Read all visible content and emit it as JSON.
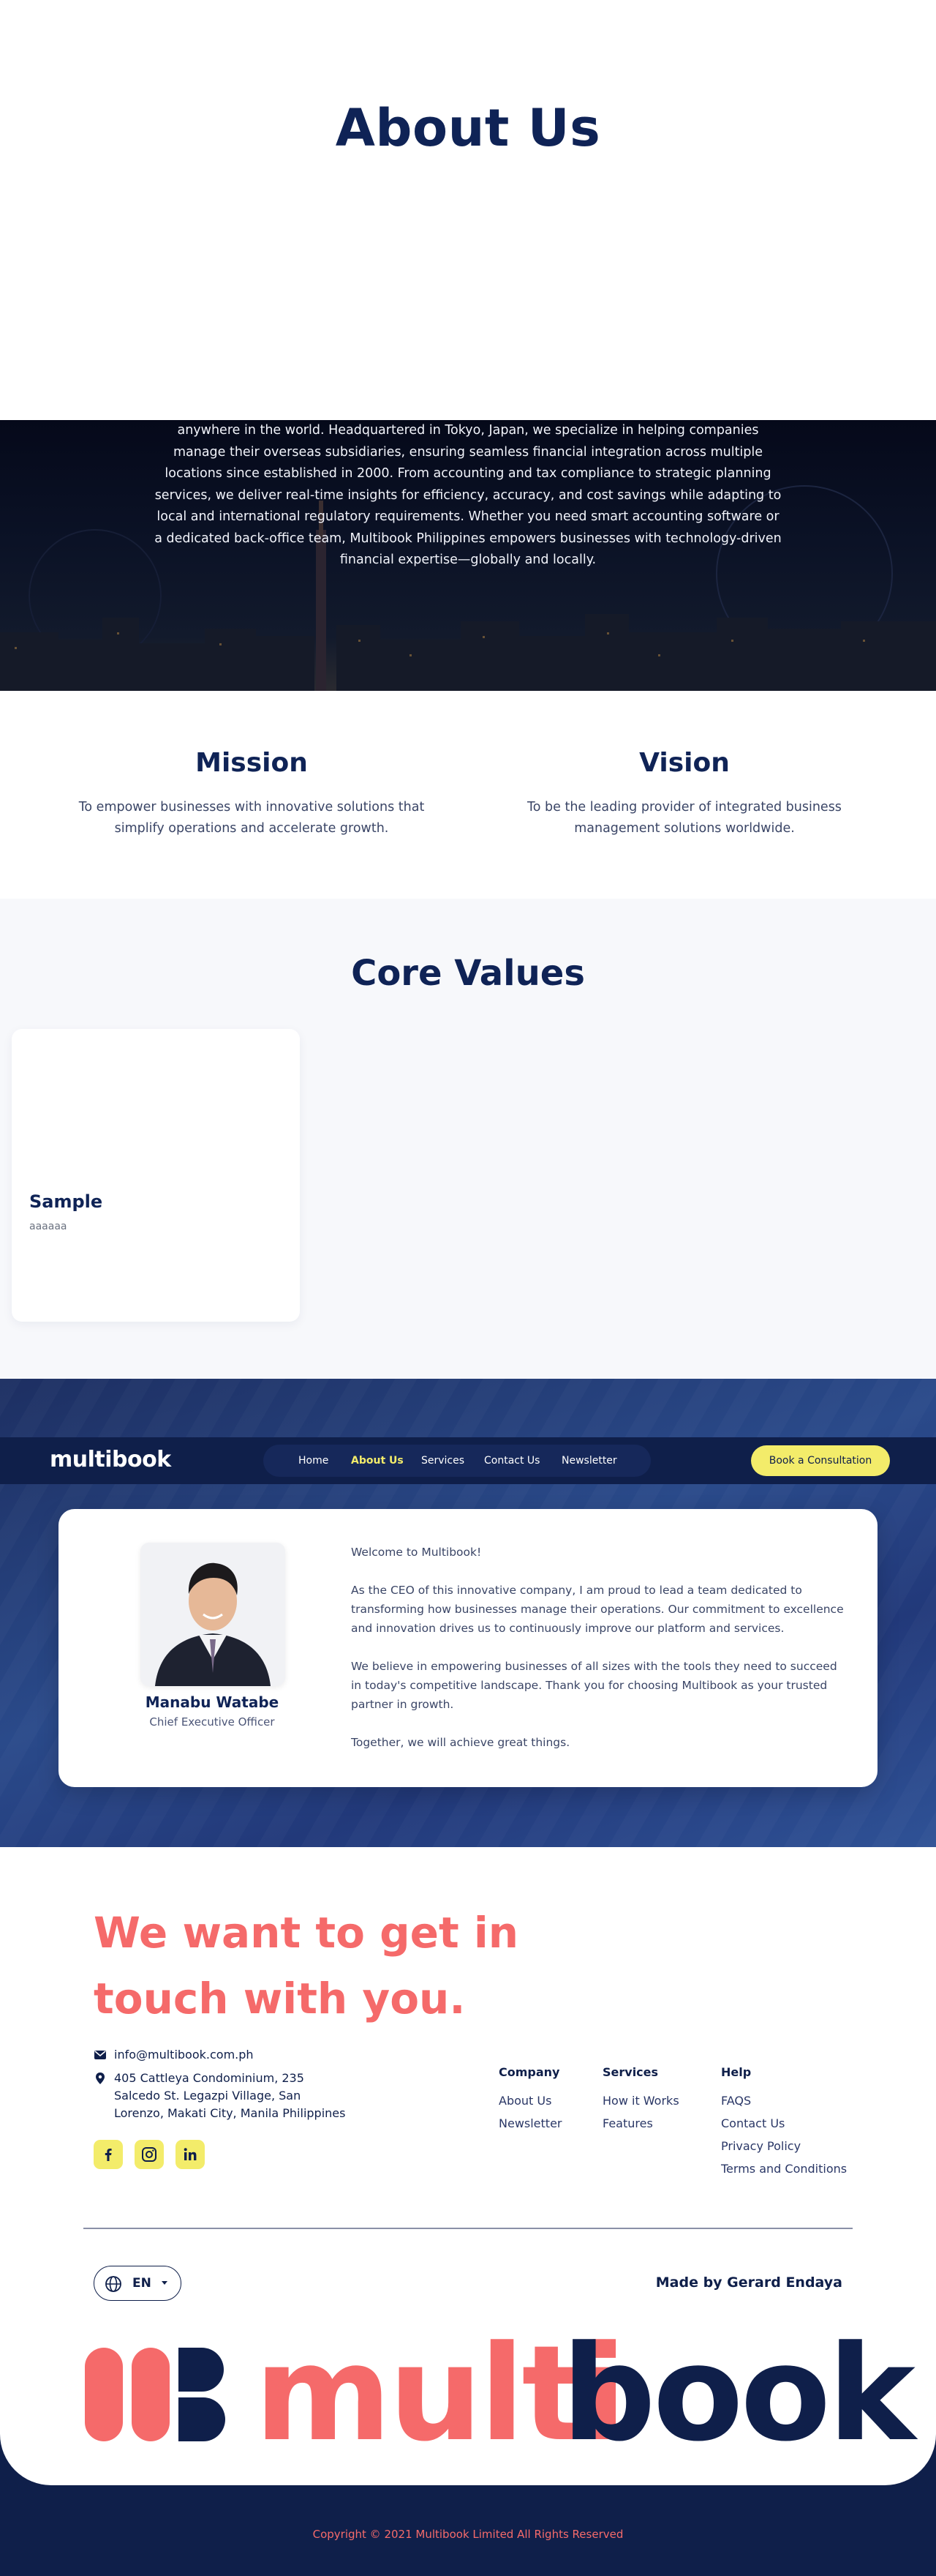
{
  "hero": {
    "title": "About Us"
  },
  "intro": {
    "text": "anywhere in the world. Headquartered in Tokyo, Japan, we specialize in helping companies manage their overseas subsidiaries, ensuring seamless financial integration across multiple locations since established in 2000. From accounting and tax compliance to strategic planning services, we deliver real-time insights for efficiency, accuracy, and cost savings while adapting to local and international regulatory requirements. Whether you need smart accounting software or a dedicated back-office team, Multibook Philippines empowers businesses with technology-driven financial expertise—globally and locally."
  },
  "mission": {
    "title": "Mission",
    "text": "To empower businesses with innovative solutions that simplify operations and accelerate growth."
  },
  "vision": {
    "title": "Vision",
    "text": "To be the leading provider of integrated business management solutions worldwide."
  },
  "core_values": {
    "title": "Core Values",
    "cards": [
      {
        "title": "Sample",
        "text": "aaaaaa"
      }
    ]
  },
  "navbar": {
    "logo": "multibook",
    "items": [
      {
        "label": "Home",
        "active": false
      },
      {
        "label": "About Us",
        "active": true
      },
      {
        "label": "Services",
        "active": false
      },
      {
        "label": "Contact Us",
        "active": false
      },
      {
        "label": "Newsletter",
        "active": false
      }
    ],
    "cta": "Book a Consultation"
  },
  "ceo": {
    "name": "Manabu Watabe",
    "role": "Chief Executive Officer",
    "paragraphs": [
      "Welcome to Multibook!",
      "As the CEO of this innovative company, I am proud to lead a team dedicated to transforming how businesses manage their operations. Our commitment to excellence and innovation drives us to continuously improve our platform and services.",
      "We believe in empowering businesses of all sizes with the tools they need to succeed in today's competitive landscape. Thank you for choosing Multibook as your trusted partner in growth.",
      "Together, we will achieve great things."
    ]
  },
  "contact": {
    "headline": "We want to get in touch with you.",
    "email": "info@multibook.com.ph",
    "address": "405 Cattleya Condominium, 235 Salcedo St. Legazpi Village, San Lorenzo, Makati City, Manila Philippines",
    "social": [
      "facebook-icon",
      "instagram-icon",
      "linkedin-icon"
    ]
  },
  "footer": {
    "columns": [
      {
        "title": "Company",
        "links": [
          "About Us",
          "Newsletter"
        ]
      },
      {
        "title": "Services",
        "links": [
          "How it Works",
          "Features"
        ]
      },
      {
        "title": "Help",
        "links": [
          "FAQS",
          "Contact Us",
          "Privacy Policy",
          "Terms and Conditions"
        ]
      }
    ],
    "language": "EN",
    "made_by": "Made by Gerard Endaya",
    "logo_part1": "multi",
    "logo_part2": "book",
    "copyright": "Copyright © 2021 Multibook Limited All Rights Reserved"
  },
  "colors": {
    "navy": "#0f1f4a",
    "coral": "#f56a6a",
    "yellow": "#f3ec6a"
  }
}
